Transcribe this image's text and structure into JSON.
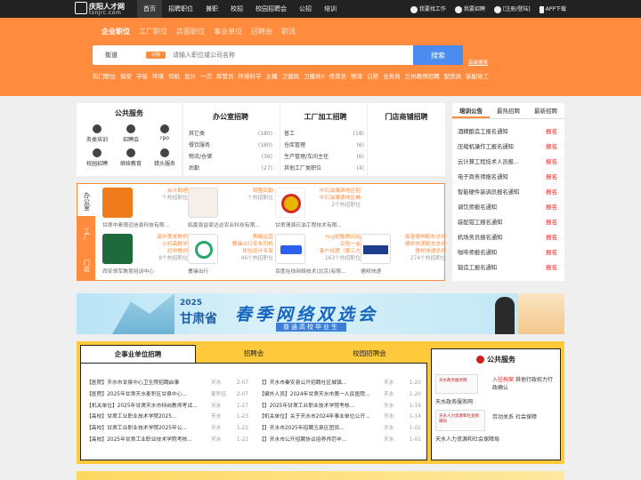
{
  "topbar": {
    "logo_main": "庆阳人才网",
    "logo_sub": "tsnjrc.com",
    "nav": [
      "首页",
      "招聘职位",
      "兼职",
      "校招",
      "校园招聘会",
      "公招",
      "培训"
    ],
    "links": [
      "我要找工作",
      "我要招聘",
      "[注册/登陆]",
      "APP下载"
    ]
  },
  "search": {
    "tabs": [
      "企业职位",
      "工厂职位",
      "店面职位",
      "事业单位",
      "招聘会",
      "职讯"
    ],
    "city": "街道",
    "city_btn": "切换",
    "placeholder": "请输入职位或公司名称",
    "button": "搜索",
    "advanced": "高级搜索",
    "hot": [
      "热门职位",
      "保安",
      "学徒",
      "环境",
      "司机",
      "会计",
      "一次",
      "库管员",
      "环境科学",
      "主播",
      "卫健局",
      "卫健局0",
      "传菜员",
      "物流",
      "白搭",
      "业务员",
      "兰州教师招聘",
      "配货员",
      "装配钳工"
    ]
  },
  "services": {
    "title": "公共服务",
    "items": [
      "务类培训",
      "招聘会",
      "rpo",
      "校园招聘",
      "继续教育",
      "猎头服务"
    ]
  },
  "categories": [
    {
      "title": "办公室招聘",
      "rows": [
        [
          "其它类",
          "(180)"
        ],
        [
          "餐饮服务",
          "(180)"
        ],
        [
          "物流/仓储",
          "(36)"
        ],
        [
          "后勤",
          "(27)"
        ]
      ]
    },
    {
      "title": "工厂加工招聘",
      "rows": [
        [
          "普工",
          "(18)"
        ],
        [
          "仓库管理",
          "(6)"
        ],
        [
          "生产管理/车间主任",
          "(6)"
        ],
        [
          "其他工厂类职位",
          "(4)"
        ]
      ]
    },
    {
      "title": "门店商铺招聘",
      "rows": []
    }
  ],
  "notices": {
    "tabs": [
      "培训公告",
      "最热招聘",
      "最新招聘"
    ],
    "items": [
      [
        "酒精酿造工报名通知",
        "报名"
      ],
      [
        "压缩机操作工报名通知",
        "报名"
      ],
      [
        "云计算工程技术人员报...",
        "报名"
      ],
      [
        "电子商务师报名通知",
        "报名"
      ],
      [
        "智能硬件装调员报名通知",
        "报名"
      ],
      [
        "调饮师报名通知",
        "报名"
      ],
      [
        "装配钳工报名通知",
        "报名"
      ],
      [
        "机场务员报名通知",
        "报名"
      ],
      [
        "咖啡师报名通知",
        "报名"
      ],
      [
        "锻造工报名通知",
        "报名"
      ]
    ]
  },
  "company_tabs": [
    "办公室",
    "工厂",
    "门店"
  ],
  "companies": [
    {
      "t1": "会计助理",
      "t2": "个热招职位",
      "name": "甘肃中奥博远信息科技有限..."
    },
    {
      "t1": "销售后勤",
      "t2": "个热招职位",
      "name": "临夏县益家达达农业科技有限..."
    },
    {
      "t1": "中石油渭源地区招",
      "t2": "中石油渭源地区确",
      "t3": "2个热招职位",
      "name": "甘肃渭源石油工程技术有限..."
    },
    {
      "t1": "高中美术教师",
      "t2": "小初高数学",
      "t3": "初中教师",
      "t4": "8个热招职位",
      "name": "西安领军教育培训中心"
    },
    {
      "t1": "策略运营",
      "t2": "曹操出行专车司机",
      "t3": "体验设计专家",
      "t4": "46个热招职位",
      "name": "曹操出行"
    },
    {
      "t1": "ncg销售顾问站",
      "t2": "五险一金",
      "t3": "客户经理（第三方",
      "t4": "163个热招职位",
      "name": "百度在线网络技术(北京)有限..."
    },
    {
      "t1": "临潼德恒配车总师",
      "t2": "德邦快递配车总师",
      "t3": "德邦快递总师",
      "t4": "274个热招职位",
      "name": "德邦快递"
    }
  ],
  "banner": {
    "year": "2025",
    "province": "甘肃省",
    "main": "春季网络双选会",
    "sub": "普通高校毕业生"
  },
  "jobs": {
    "tabs": [
      "企事业单位招聘",
      "招聘会",
      "校园招聘会"
    ],
    "left": [
      [
        "【医院】天水市甘泉中心卫生院招聘启事",
        "天水",
        "2-07"
      ],
      [
        "【医院】2025年甘肃天水麦积区甘泉中心...",
        "麦积区",
        "2-07"
      ],
      [
        "【机关单位】2025年甘肃天水市特岗教师考试...",
        "天水",
        "1-27"
      ],
      [
        "【高校】甘肃工业职业技术学院2025...",
        "天水",
        "1-23"
      ],
      [
        "【高校】甘肃工业职业技术学院2025年公...",
        "天水",
        "1-22"
      ],
      [
        "【高校】2025年甘肃工业职业技术学院考核...",
        "天水",
        "1-22"
      ]
    ],
    "right": [
      [
        "【】天水市秦安县公开招聘社区城镇...",
        "天水",
        "1-20"
      ],
      [
        "【编外人员】2024年甘肃天水市第一人民医院...",
        "天水",
        "1-20"
      ],
      [
        "【】2025年甘肃工业职业技术学院考核...",
        "天水",
        "1-16"
      ],
      [
        "【机关单位】关于天水市2024年事业单位公开...",
        "天水",
        "1-14"
      ],
      [
        "【】天水市2025年招聘玉泉区团员...",
        "天水",
        "1-01"
      ],
      [
        "【】天水市公开招聘协议培养师范毕...",
        "天水",
        "1-01"
      ]
    ]
  },
  "public": {
    "title": "公共服务",
    "items": [
      {
        "logo_text": "天水政务服务网",
        "label": "天水政务服务网",
        "extra1": "入驻档案",
        "extra2": "其他行政权力行政确认"
      },
      {
        "logo_text": "天水人力资源和社会保障局",
        "label": "天水人力资源和社会保障局",
        "extra1": "劳动关系",
        "extra2": "社会保障"
      }
    ]
  }
}
